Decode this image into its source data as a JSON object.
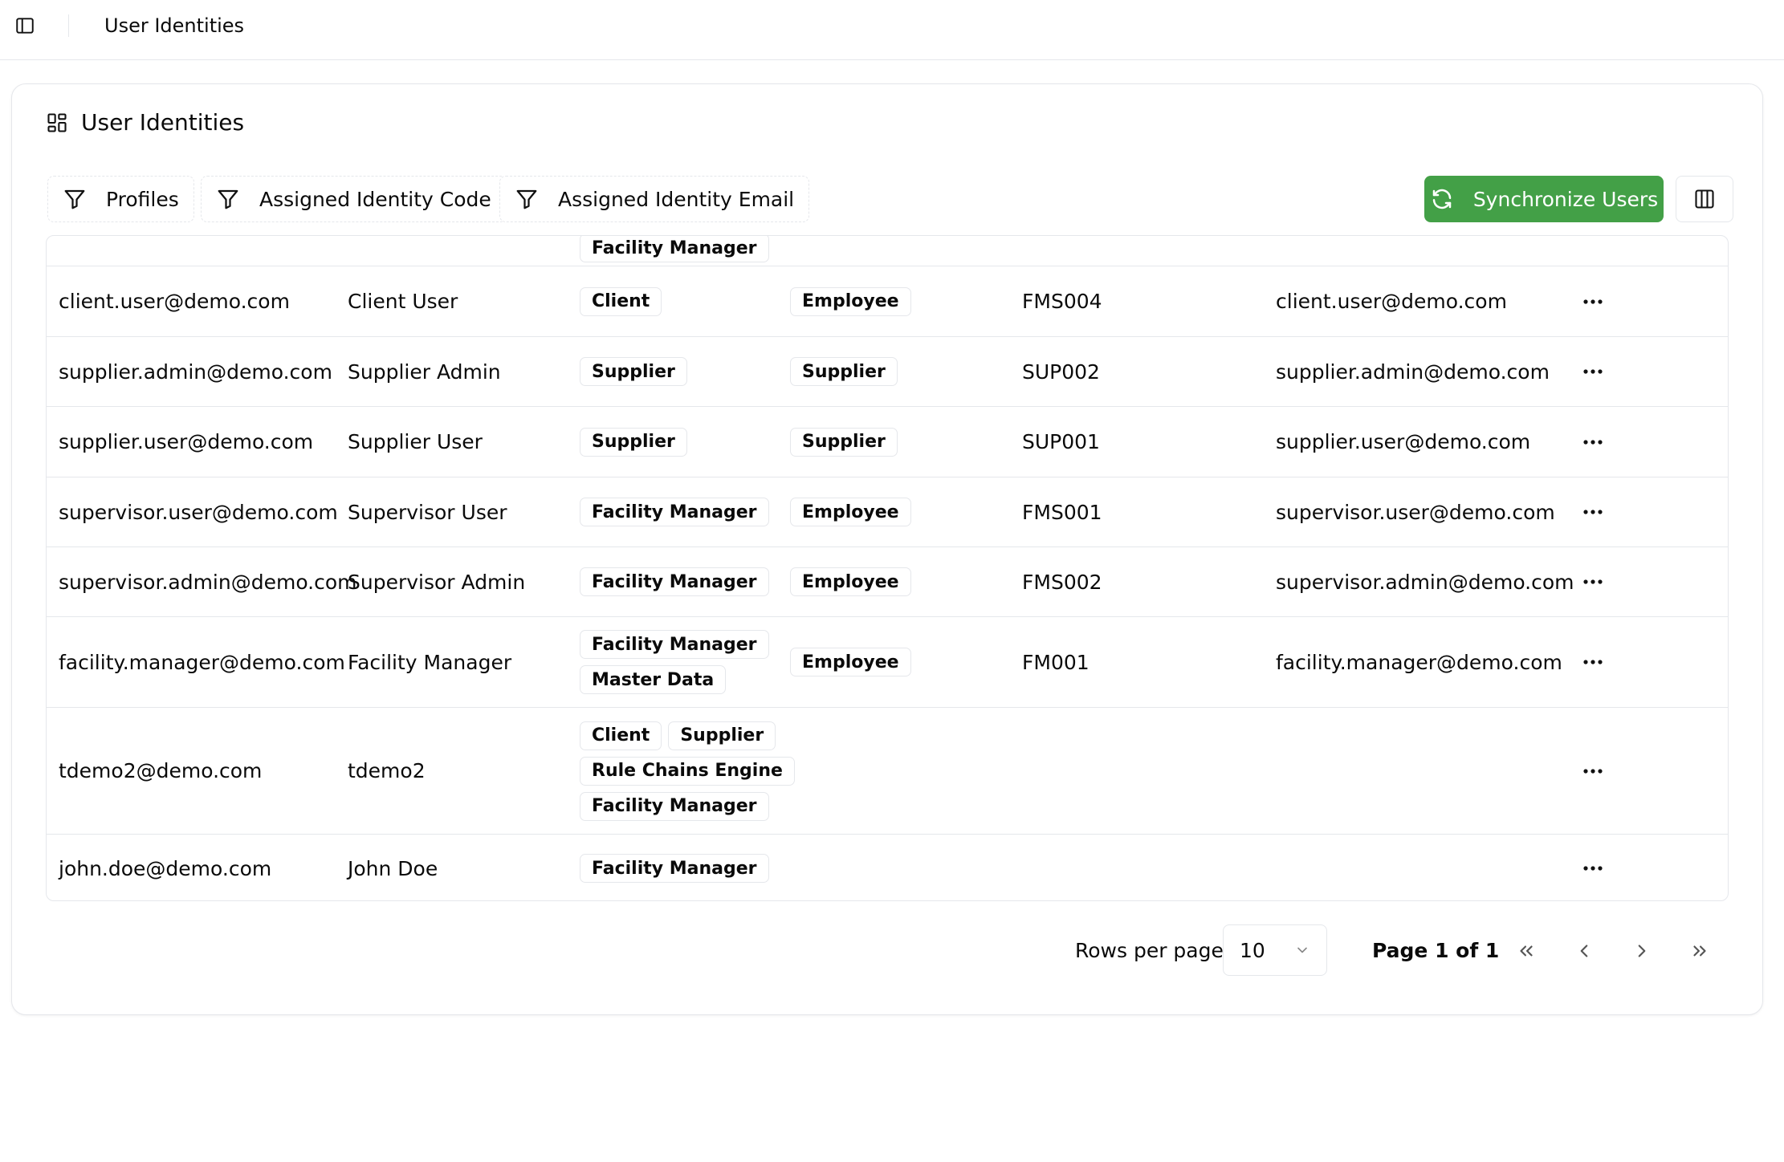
{
  "topbar": {
    "title": "User Identities"
  },
  "card": {
    "title": "User Identities"
  },
  "toolbar": {
    "filters": [
      "Profiles",
      "Assigned Identity Code",
      "Assigned Identity Email"
    ],
    "sync_label": "Synchronize Users"
  },
  "colors": {
    "accent_green": "#43a047",
    "border": "#e5e7eb"
  },
  "table": {
    "partial_top_row": {
      "profiles": [
        "Facility Manager"
      ]
    },
    "rows": [
      {
        "email": "client.user@demo.com",
        "name": "Client User",
        "profiles": [
          [
            "Client"
          ]
        ],
        "type": "Employee",
        "code": "FMS004",
        "assigned_email": "client.user@demo.com"
      },
      {
        "email": "supplier.admin@demo.com",
        "name": "Supplier Admin",
        "profiles": [
          [
            "Supplier"
          ]
        ],
        "type": "Supplier",
        "code": "SUP002",
        "assigned_email": "supplier.admin@demo.com"
      },
      {
        "email": "supplier.user@demo.com",
        "name": "Supplier User",
        "profiles": [
          [
            "Supplier"
          ]
        ],
        "type": "Supplier",
        "code": "SUP001",
        "assigned_email": "supplier.user@demo.com"
      },
      {
        "email": "supervisor.user@demo.com",
        "name": "Supervisor User",
        "profiles": [
          [
            "Facility Manager"
          ]
        ],
        "type": "Employee",
        "code": "FMS001",
        "assigned_email": "supervisor.user@demo.com"
      },
      {
        "email": "supervisor.admin@demo.com",
        "name": "Supervisor Admin",
        "profiles": [
          [
            "Facility Manager"
          ]
        ],
        "type": "Employee",
        "code": "FMS002",
        "assigned_email": "supervisor.admin@demo.com"
      },
      {
        "email": "facility.manager@demo.com",
        "name": "Facility Manager",
        "profiles": [
          [
            "Facility Manager"
          ],
          [
            "Master Data"
          ]
        ],
        "type": "Employee",
        "code": "FM001",
        "assigned_email": "facility.manager@demo.com"
      },
      {
        "email": "tdemo2@demo.com",
        "name": "tdemo2",
        "profiles": [
          [
            "Client",
            "Supplier"
          ],
          [
            "Rule Chains Engine"
          ],
          [
            "Facility Manager"
          ]
        ],
        "type": "",
        "code": "",
        "assigned_email": ""
      },
      {
        "email": "john.doe@demo.com",
        "name": "John Doe",
        "profiles": [
          [
            "Facility Manager"
          ]
        ],
        "type": "",
        "code": "",
        "assigned_email": ""
      }
    ]
  },
  "pagination": {
    "rows_per_page_label": "Rows per page",
    "rows_per_page_value": "10",
    "page_info": "Page 1 of 1"
  }
}
